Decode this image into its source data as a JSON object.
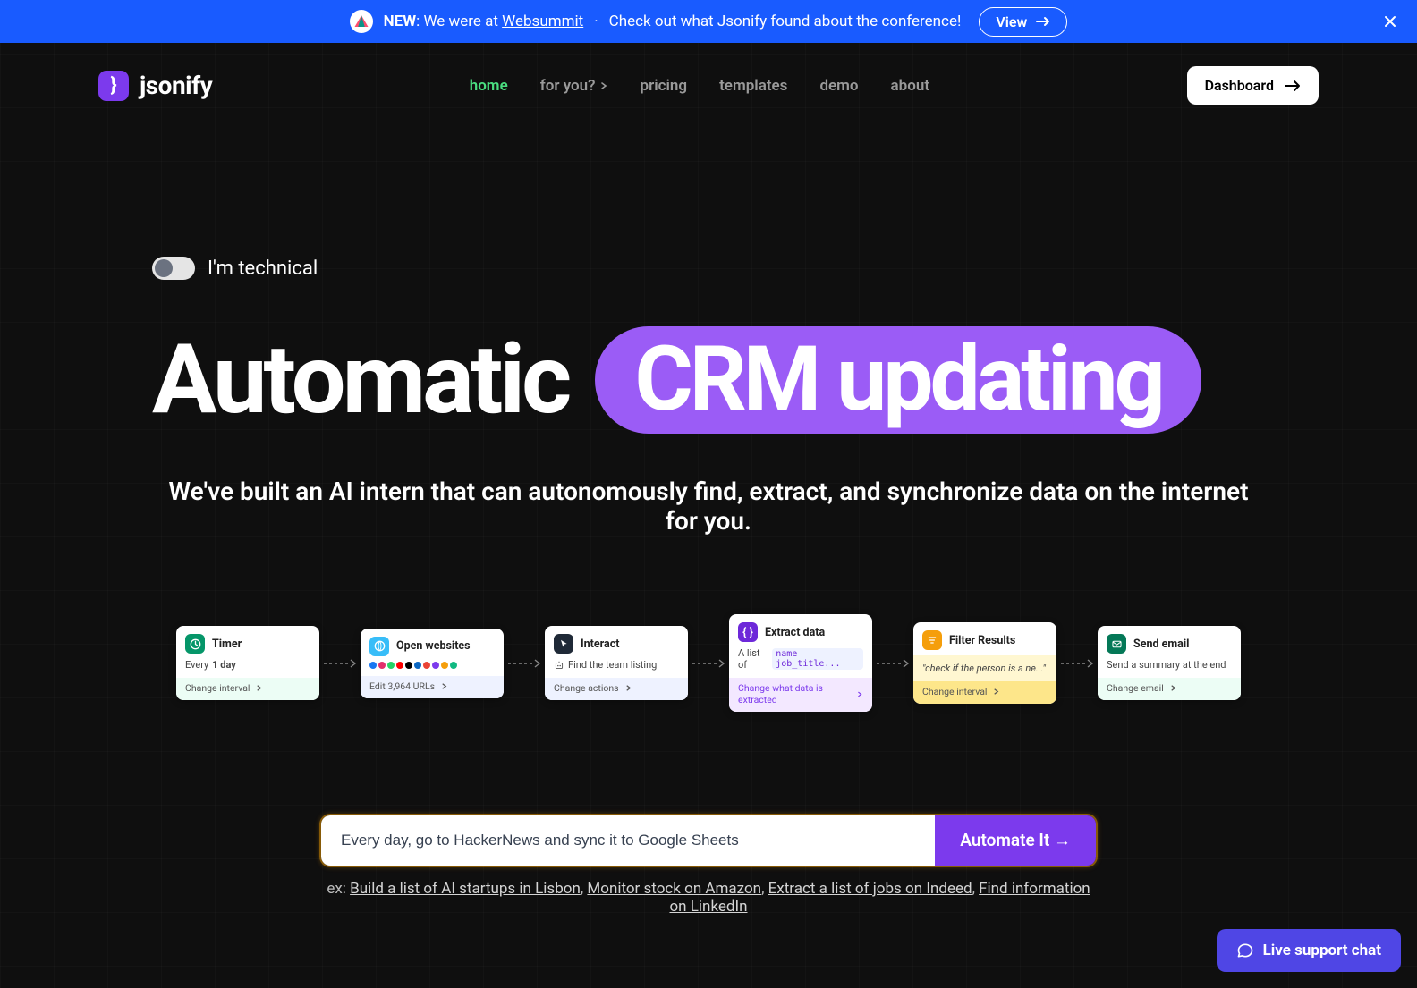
{
  "banner": {
    "new_label": "NEW",
    "prefix": ": We were at ",
    "link": "Websummit",
    "sep": "·",
    "suffix": "Check out what Jsonify found about the conference!",
    "view": "View"
  },
  "brand": {
    "name": "jsonify",
    "mark": "}"
  },
  "nav": {
    "home": "home",
    "for_you": "for you?",
    "pricing": "pricing",
    "templates": "templates",
    "demo": "demo",
    "about": "about",
    "dashboard": "Dashboard"
  },
  "hero": {
    "toggle_label": "I'm technical",
    "headline_static": "Automatic",
    "headline_pill": "CRM updating",
    "sub": "We've built an AI intern that can autonomously find, extract, and synchronize data on the internet for you."
  },
  "cards": {
    "timer": {
      "title": "Timer",
      "body_prefix": "Every ",
      "body_bold": "1 day",
      "footer": "Change interval"
    },
    "open": {
      "title": "Open websites",
      "footer": "Edit 3,964 URLs"
    },
    "interact": {
      "title": "Interact",
      "body": "Find the team listing",
      "footer": "Change actions"
    },
    "extract": {
      "title": "Extract data",
      "body_prefix": "A list of ",
      "code": "name job_title...",
      "footer": "Change what data is extracted"
    },
    "filter": {
      "title": "Filter Results",
      "body": "\"check if the person is a ne...\"",
      "footer": "Change interval"
    },
    "email": {
      "title": "Send email",
      "body": "Send a summary at the end",
      "footer": "Change email"
    }
  },
  "prompt": {
    "value": "Every day, go to HackerNews and sync it to Google Sheets",
    "button": "Automate It →"
  },
  "examples": {
    "prefix": "ex: ",
    "items": [
      "Build a list of AI startups in Lisbon",
      "Monitor stock on Amazon",
      "Extract a list of jobs on Indeed",
      "Find information on LinkedIn"
    ]
  },
  "support": "Live support chat"
}
